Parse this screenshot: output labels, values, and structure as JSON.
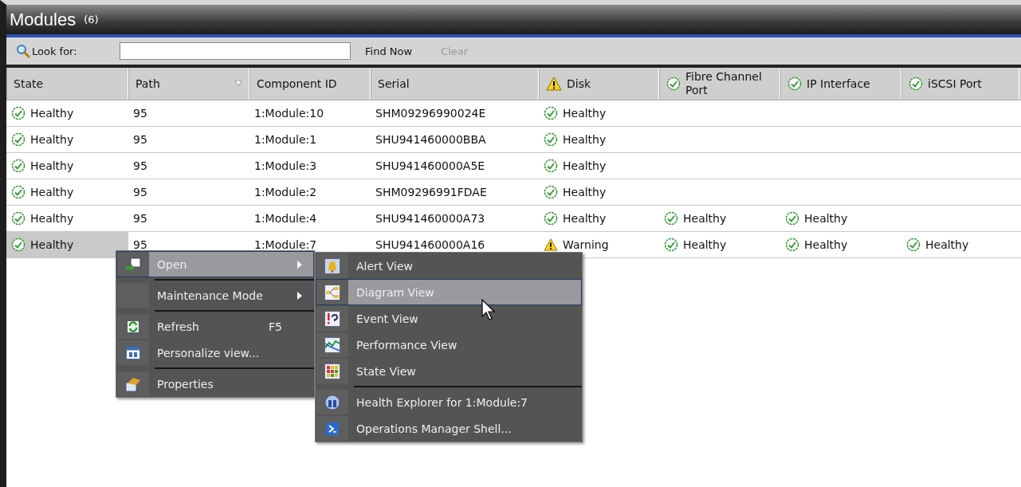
{
  "title": {
    "name": "Modules",
    "count": "(6)"
  },
  "toolbar": {
    "search_label": "Look for:",
    "find_button": "Find Now",
    "clear_button": {
      "label": "Clear",
      "disabled": true
    }
  },
  "columns": [
    {
      "label": "State",
      "sort": false
    },
    {
      "label": "Path",
      "sort": true
    },
    {
      "label": "Component ID",
      "sort": false
    },
    {
      "label": "Serial",
      "sort": false
    },
    {
      "label": "Disk",
      "kind": "warning",
      "sort": false
    },
    {
      "label": "Fibre Channel Port",
      "kind": "healthy",
      "sort": false
    },
    {
      "label": "IP Interface",
      "kind": "healthy",
      "sort": false
    },
    {
      "label": "iSCSI Port",
      "kind": "healthy",
      "sort": false
    }
  ],
  "rows": [
    {
      "selected": false,
      "cells": [
        {
          "kind": "healthy",
          "text": "Healthy"
        },
        {
          "text": "95"
        },
        {
          "text": "1:Module:10"
        },
        {
          "text": "SHM09296990024E"
        },
        {
          "kind": "healthy",
          "text": "Healthy"
        }
      ]
    },
    {
      "selected": false,
      "cells": [
        {
          "kind": "healthy",
          "text": "Healthy"
        },
        {
          "text": "95"
        },
        {
          "text": "1:Module:1"
        },
        {
          "text": "SHU941460000BBA"
        },
        {
          "kind": "healthy",
          "text": "Healthy"
        }
      ]
    },
    {
      "selected": false,
      "cells": [
        {
          "kind": "healthy",
          "text": "Healthy"
        },
        {
          "text": "95"
        },
        {
          "text": "1:Module:3"
        },
        {
          "text": "SHU941460000A5E"
        },
        {
          "kind": "healthy",
          "text": "Healthy"
        }
      ]
    },
    {
      "selected": false,
      "cells": [
        {
          "kind": "healthy",
          "text": "Healthy"
        },
        {
          "text": "95"
        },
        {
          "text": "1:Module:2"
        },
        {
          "text": "SHM09296991FDAE"
        },
        {
          "kind": "healthy",
          "text": "Healthy"
        }
      ]
    },
    {
      "selected": false,
      "cells": [
        {
          "kind": "healthy",
          "text": "Healthy"
        },
        {
          "text": "95"
        },
        {
          "text": "1:Module:4"
        },
        {
          "text": "SHU941460000A73"
        },
        {
          "kind": "healthy",
          "text": "Healthy"
        },
        {
          "kind": "healthy",
          "text": "Healthy"
        },
        {
          "kind": "healthy",
          "text": "Healthy"
        }
      ]
    },
    {
      "selected": true,
      "cells": [
        {
          "kind": "healthy",
          "text": "Healthy"
        },
        {
          "text": "95"
        },
        {
          "text": "1:Module:7"
        },
        {
          "text": "SHU941460000A16"
        },
        {
          "kind": "warning",
          "text": "Warning"
        },
        {
          "kind": "healthy",
          "text": "Healthy"
        },
        {
          "kind": "healthy",
          "text": "Healthy"
        },
        {
          "kind": "healthy",
          "text": "Healthy"
        }
      ]
    }
  ],
  "context_menu": [
    {
      "kind": "item",
      "label": "Open",
      "submenu": true,
      "selected": true
    },
    {
      "kind": "separator"
    },
    {
      "kind": "item",
      "label": "Maintenance Mode",
      "submenu": true,
      "selected": false
    },
    {
      "kind": "separator"
    },
    {
      "kind": "item",
      "label": "Refresh",
      "shortcut": "F5",
      "selected": false
    },
    {
      "kind": "item",
      "label": "Personalize view...",
      "selected": false
    },
    {
      "kind": "separator"
    },
    {
      "kind": "item",
      "label": "Properties",
      "selected": false
    }
  ],
  "submenu": [
    {
      "kind": "item",
      "label": "Alert View",
      "selected": false
    },
    {
      "kind": "item",
      "label": "Diagram View",
      "selected": true
    },
    {
      "kind": "item",
      "label": "Event View",
      "selected": false
    },
    {
      "kind": "item",
      "label": "Performance View",
      "selected": false
    },
    {
      "kind": "item",
      "label": "State View",
      "selected": false
    },
    {
      "kind": "separator"
    },
    {
      "kind": "item",
      "label": "Health Explorer for 1:Module:7",
      "selected": false
    },
    {
      "kind": "item",
      "label": "Operations Manager Shell...",
      "selected": false
    }
  ]
}
